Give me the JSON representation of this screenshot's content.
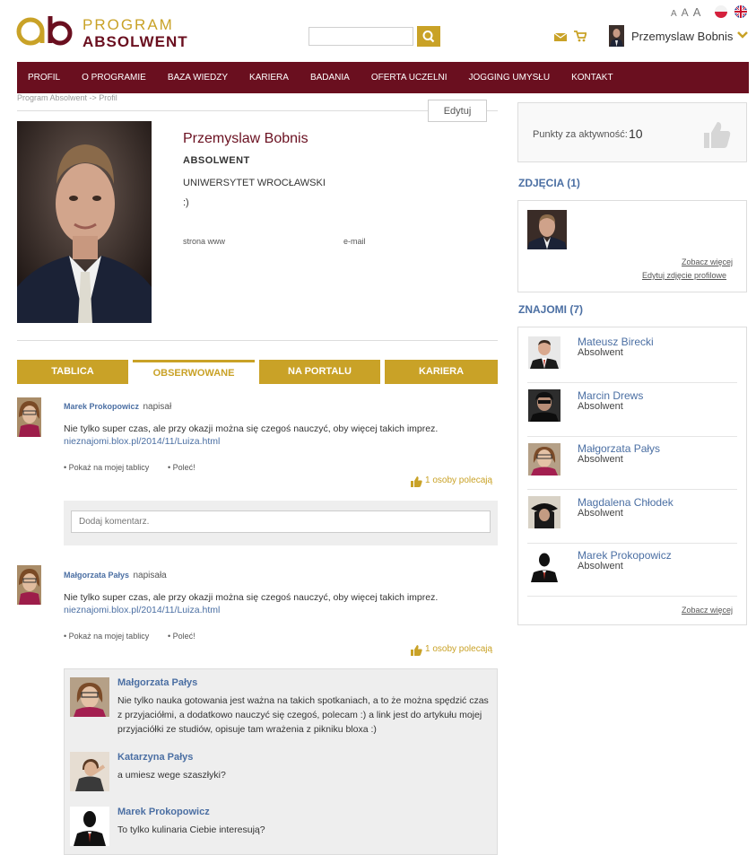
{
  "header": {
    "logo_program": "PROGRAM",
    "logo_absolwent": "ABSOLWENT",
    "search_value": "",
    "font_sizes": [
      "A",
      "A",
      "A"
    ],
    "user_name": "Przemyslaw Bobnis",
    "accent_color": "#c9a227",
    "brand_color": "#6a0f1f"
  },
  "nav": {
    "items": [
      "PROFIL",
      "O PROGRAMIE",
      "BAZA WIEDZY",
      "KARIERA",
      "BADANIA",
      "OFERTA UCZELNI",
      "JOGGING UMYSŁU",
      "KONTAKT"
    ]
  },
  "breadcrumb": "Program Absolwent -> Profil",
  "edit_label": "Edytuj",
  "profile": {
    "name": "Przemyslaw Bobnis",
    "role": "ABSOLWENT",
    "university": "UNIWERSYTET WROCŁAWSKI",
    "status": ":)",
    "www_label": "strona www",
    "email_label": "e-mail"
  },
  "tabs": [
    "TABLICA",
    "OBSERWOWANE",
    "NA PORTALU",
    "KARIERA"
  ],
  "posts": [
    {
      "author": "Marek Prokopowicz",
      "verb": "napisał",
      "text": "Nie tylko super czas, ale przy okazji można się czegoś nauczyć, oby więcej takich imprez.",
      "link": "nieznajomi.blox.pl/2014/11/Luiza.html",
      "action_show": "• Pokaż na mojej tablicy",
      "action_recommend": "• Poleć!",
      "likes": "1 osoby polecają",
      "comment_placeholder": "Dodaj komentarz."
    },
    {
      "author": "Małgorzata Pałys",
      "verb": "napisała",
      "text": "Nie tylko super czas, ale przy okazji można się czegoś nauczyć, oby więcej takich imprez.",
      "link": "nieznajomi.blox.pl/2014/11/Luiza.html",
      "action_show": "• Pokaż na mojej tablicy",
      "action_recommend": "• Poleć!",
      "likes": "1 osoby polecają"
    }
  ],
  "comments": [
    {
      "name": "Małgorzata Pałys",
      "text": "Nie tylko nauka gotowania jest ważna na takich spotkaniach, a to że można spędzić czas z przyjaciółmi, a dodatkowo nauczyć się czegoś, polecam :) a link jest do artykułu mojej przyjaciółki ze studiów, opisuje tam wrażenia z pikniku bloxa :)"
    },
    {
      "name": "Katarzyna Pałys",
      "text": "a umiesz wege szaszłyki?"
    },
    {
      "name": "Marek Prokopowicz",
      "text": "To tylko kulinaria Ciebie interesują?"
    }
  ],
  "sidebar": {
    "points_label": "Punkty za aktywność:",
    "points_value": "10",
    "photos_title": "ZDJĘCIA (1)",
    "photos_more": "Zobacz więcej",
    "photos_edit": "Edytuj zdjęcie profilowe",
    "friends_title": "ZNAJOMI (7)",
    "friends": [
      {
        "name": "Mateusz Birecki",
        "role": "Absolwent"
      },
      {
        "name": "Marcin Drews",
        "role": "Absolwent"
      },
      {
        "name": "Małgorzata Pałys",
        "role": "Absolwent"
      },
      {
        "name": "Magdalena Chłodek",
        "role": "Absolwent"
      },
      {
        "name": "Marek Prokopowicz",
        "role": "Absolwent"
      }
    ],
    "friends_more": "Zobacz więcej"
  }
}
